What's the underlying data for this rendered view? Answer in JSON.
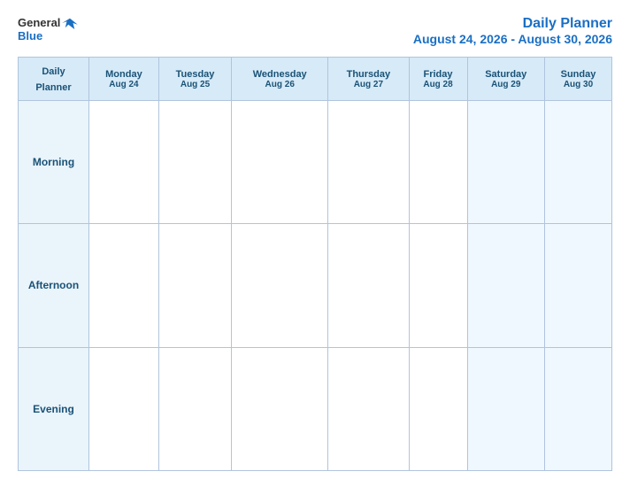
{
  "logo": {
    "general": "General",
    "blue": "Blue"
  },
  "header": {
    "title": "Daily Planner",
    "date_range": "August 24, 2026 - August 30, 2026"
  },
  "table": {
    "label_row": {
      "line1": "Daily",
      "line2": "Planner"
    },
    "columns": [
      {
        "day": "Monday",
        "date": "Aug 24"
      },
      {
        "day": "Tuesday",
        "date": "Aug 25"
      },
      {
        "day": "Wednesday",
        "date": "Aug 26"
      },
      {
        "day": "Thursday",
        "date": "Aug 27"
      },
      {
        "day": "Friday",
        "date": "Aug 28"
      },
      {
        "day": "Saturday",
        "date": "Aug 29"
      },
      {
        "day": "Sunday",
        "date": "Aug 30"
      }
    ],
    "rows": [
      {
        "label": "Morning"
      },
      {
        "label": "Afternoon"
      },
      {
        "label": "Evening"
      }
    ]
  }
}
